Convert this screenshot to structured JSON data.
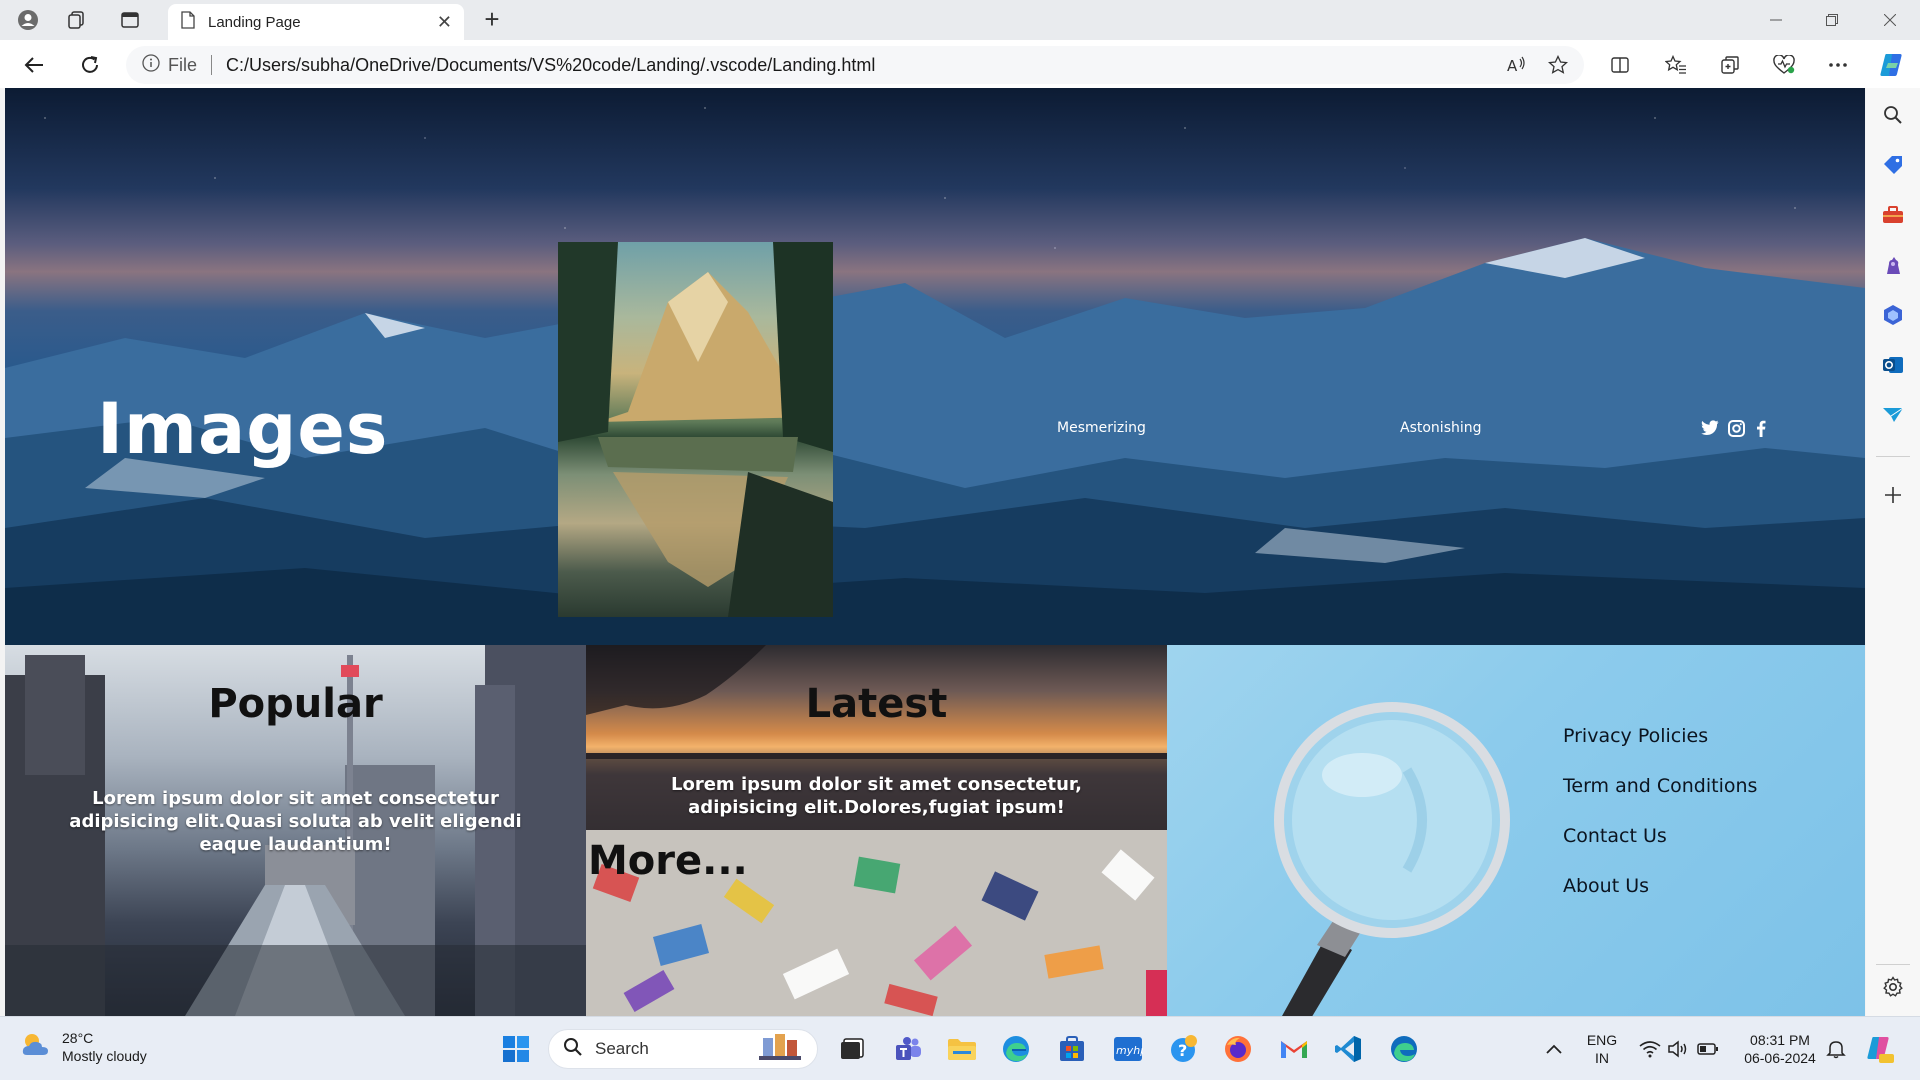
{
  "browser": {
    "tab_title": "Landing Page",
    "address": {
      "file_label": "File",
      "url": "C:/Users/subha/OneDrive/Documents/VS%20code/Landing/.vscode/Landing.html"
    }
  },
  "hero": {
    "title": "Images",
    "links": [
      "Mesmerizing",
      "Astonishing"
    ],
    "social_icons": [
      "twitter-icon",
      "instagram-icon",
      "facebook-icon"
    ]
  },
  "cards": {
    "popular": {
      "heading": "Popular",
      "text": "Lorem ipsum dolor sit amet consectetur adipisicing elit.Quasi soluta ab velit eligendi eaque laudantium!"
    },
    "latest": {
      "heading": "Latest",
      "text": "Lorem ipsum dolor sit amet consectetur, adipisicing elit.Dolores,fugiat ipsum!"
    },
    "more": {
      "heading": "More..."
    },
    "links": [
      "Privacy Policies",
      "Term and Conditions",
      "Contact Us",
      "About Us"
    ]
  },
  "taskbar": {
    "weather": {
      "temp": "28°C",
      "condition": "Mostly cloudy"
    },
    "search_label": "Search",
    "language": {
      "lang": "ENG",
      "region": "IN"
    },
    "clock": {
      "time": "08:31 PM",
      "date": "06-06-2024"
    }
  },
  "colors": {
    "edge_accent": "#0f6cbd",
    "hero_deep_blue": "#1e4f80",
    "links_card_blue": "#8ccbec"
  }
}
